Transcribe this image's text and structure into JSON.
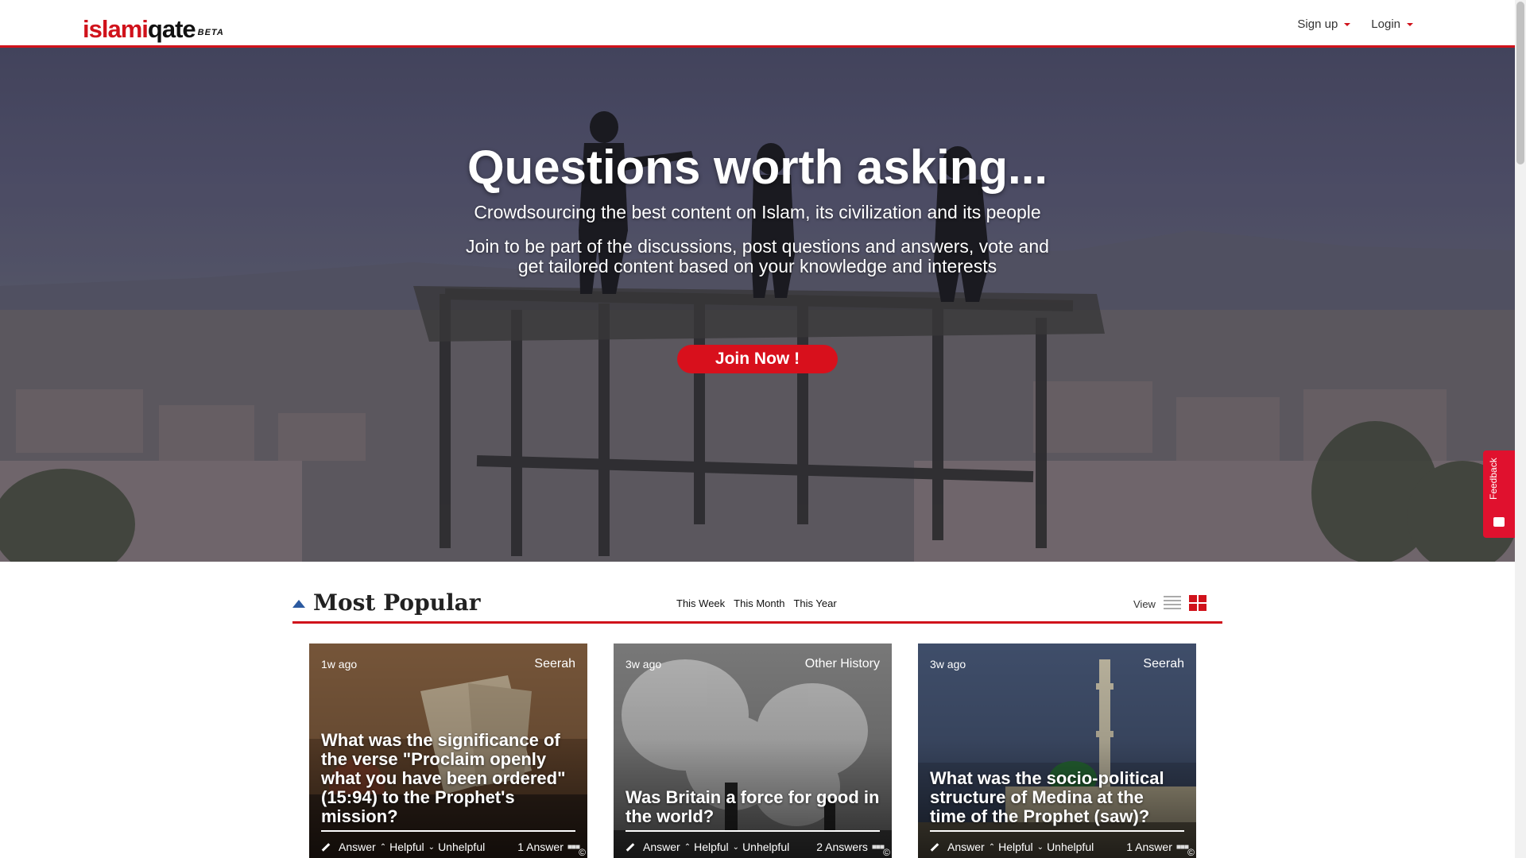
{
  "header": {
    "logo_islami": "islami",
    "logo_qate": "qate",
    "logo_beta": "BETA",
    "nav": [
      {
        "label": "Sign up"
      },
      {
        "label": "Login"
      }
    ]
  },
  "hero": {
    "title": "Questions worth asking...",
    "subtitle": "Crowdsourcing the best content on Islam, its civilization and its people",
    "description": "Join to be part of the discussions, post questions and answers, vote and get tailored content based on your knowledge and interests",
    "cta": "Join Now !"
  },
  "feedback": {
    "label": "Feedback"
  },
  "section": {
    "title": "Most Popular",
    "filters": [
      "This Week",
      "This Month",
      "This Year"
    ],
    "view_label": "View"
  },
  "cards": [
    {
      "time": "1w ago",
      "category": "Seerah",
      "title": "What was the significance of the verse \"Proclaim openly what you have been ordered\" (15:94) to the Prophet's mission?",
      "answer_label": "Answer",
      "helpful_label": "Helpful",
      "unhelpful_label": "Unhelpful",
      "answers": "1 Answer"
    },
    {
      "time": "3w ago",
      "category": "Other History",
      "title": "Was Britain a force for good in the world?",
      "answer_label": "Answer",
      "helpful_label": "Helpful",
      "unhelpful_label": "Unhelpful",
      "answers": "2 Answers"
    },
    {
      "time": "3w ago",
      "category": "Seerah",
      "title": "What was the socio-political structure of Medina at the time of the Prophet (saw)?",
      "answer_label": "Answer",
      "helpful_label": "Helpful",
      "unhelpful_label": "Unhelpful",
      "answers": "1 Answer"
    }
  ],
  "colors": {
    "accent": "#d0121b",
    "join_button": "#d8101c",
    "feedback_tab": "#e0112e",
    "section_arrow": "#2c5aa0"
  },
  "icons": {
    "caret": "caret-down-icon",
    "section": "triangle-up-icon",
    "list_view": "list-view-icon",
    "grid_view": "grid-view-icon",
    "answer": "pencil-icon",
    "helpful": "chevron-up-icon",
    "unhelpful": "chevron-down-icon",
    "more": "dots-icon",
    "copyright": "copyright-icon",
    "feedback": "chat-icon"
  }
}
